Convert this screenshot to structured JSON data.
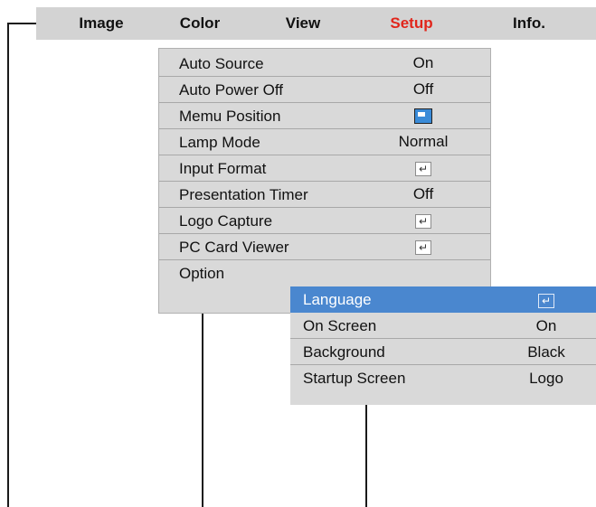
{
  "menu": {
    "tabs": [
      {
        "label": "Image",
        "color": "#111111"
      },
      {
        "label": "Color",
        "color": "#111111"
      },
      {
        "label": "View",
        "color": "#111111"
      },
      {
        "label": "Setup",
        "color": "#e1251b"
      },
      {
        "label": "Info.",
        "color": "#111111"
      }
    ]
  },
  "setup": {
    "items": [
      {
        "label": "Auto Source",
        "value": "On"
      },
      {
        "label": "Auto Power Off",
        "value": "Off"
      },
      {
        "label": "Memu Position",
        "icon": "menu-position-icon"
      },
      {
        "label": "Lamp Mode",
        "value": "Normal"
      },
      {
        "label": "Input Format",
        "icon": "enter-icon"
      },
      {
        "label": "Presentation Timer",
        "value": "Off"
      },
      {
        "label": "Logo Capture",
        "icon": "enter-icon"
      },
      {
        "label": "PC Card Viewer",
        "icon": "enter-icon"
      },
      {
        "label": "Option"
      }
    ]
  },
  "option": {
    "items": [
      {
        "label": "Language",
        "icon": "enter-icon",
        "selected": true
      },
      {
        "label": "On Screen",
        "value": "On"
      },
      {
        "label": "Background",
        "value": "Black"
      },
      {
        "label": "Startup Screen",
        "value": "Logo"
      }
    ]
  },
  "colors": {
    "menubar": "#d3d3d3",
    "active_tab": "#e1251b",
    "selected_row": "#4a87cf",
    "panel": "#d9d9d9"
  }
}
